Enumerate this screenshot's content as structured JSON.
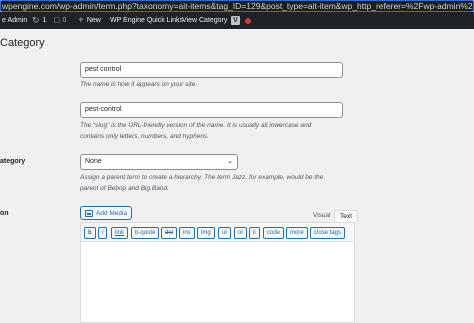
{
  "browser": {
    "url": "wpengine.com/wp-admin/term.php?taxonomy=ait-items&tag_ID=129&post_type=ait-item&wp_http_referer=%2Fwp-admin%2Fedit-tags.php%3"
  },
  "adminbar": {
    "site_label": "e Admin",
    "updates_count": "1",
    "comments_count": "0",
    "new_label": "New",
    "quick_links_label": "WP Engine Quick Links",
    "view_category_label": "View Category",
    "v_badge": "V",
    "status_color": "#d63638"
  },
  "page": {
    "title": "Category"
  },
  "form": {
    "name": {
      "value": "pest control",
      "description": "The name is how it appears on your site."
    },
    "slug": {
      "value": "pest-control",
      "description_line1": "The “slug” is the URL-friendly version of the name. It is usually all lowercase and",
      "description_line2": "contains only letters, numbers, and hyphens."
    },
    "parent": {
      "label": "ategory",
      "selected": "None",
      "description_line1": "Assign a parent term to create a hierarchy. The term Jazz, for example, would be the",
      "description_line2": "parent of Bebop and Big Band."
    },
    "icon": {
      "label": "on"
    }
  },
  "editor": {
    "add_media_label": "Add Media",
    "tab_visual": "Visual",
    "tab_text": "Text",
    "quicktags": [
      "b",
      "i",
      "link",
      "b-quote",
      "del",
      "ins",
      "img",
      "ul",
      "ol",
      "li",
      "code",
      "more",
      "close tags"
    ]
  },
  "colors": {
    "adminbar_bg": "#1d2327",
    "accent": "#2271b1",
    "page_bg": "#f0f0f1"
  }
}
